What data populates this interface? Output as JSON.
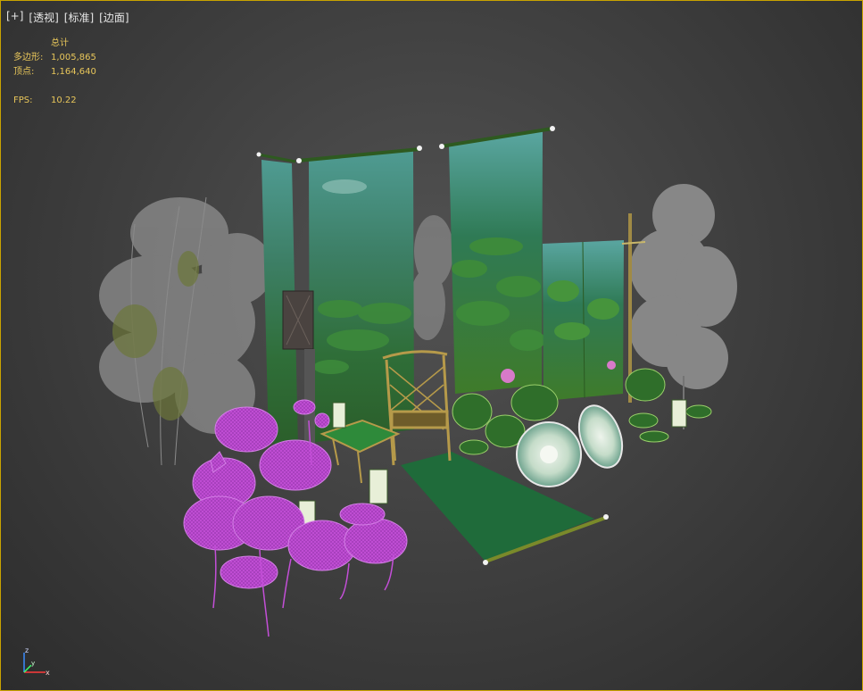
{
  "viewport": {
    "labels": [
      "[+]",
      "[透视]",
      "[标准]",
      "[边面]"
    ],
    "border_color": "#c9a300"
  },
  "stats": {
    "total_label": "总计",
    "polygons_label": "多边形:",
    "polygons_value": "1,005,865",
    "vertices_label": "顶点:",
    "vertices_value": "1,164,640",
    "fps_label": "FPS:",
    "fps_value": "10.22",
    "text_color": "#e8c65a"
  },
  "axis_gizmo": {
    "x": "x",
    "y": "y",
    "z": "z"
  },
  "colors": {
    "selection": "#c44fd8",
    "bamboo": "#8a8a8a",
    "carpet": "#1f6b3a",
    "banner": "#2f6b4a"
  }
}
